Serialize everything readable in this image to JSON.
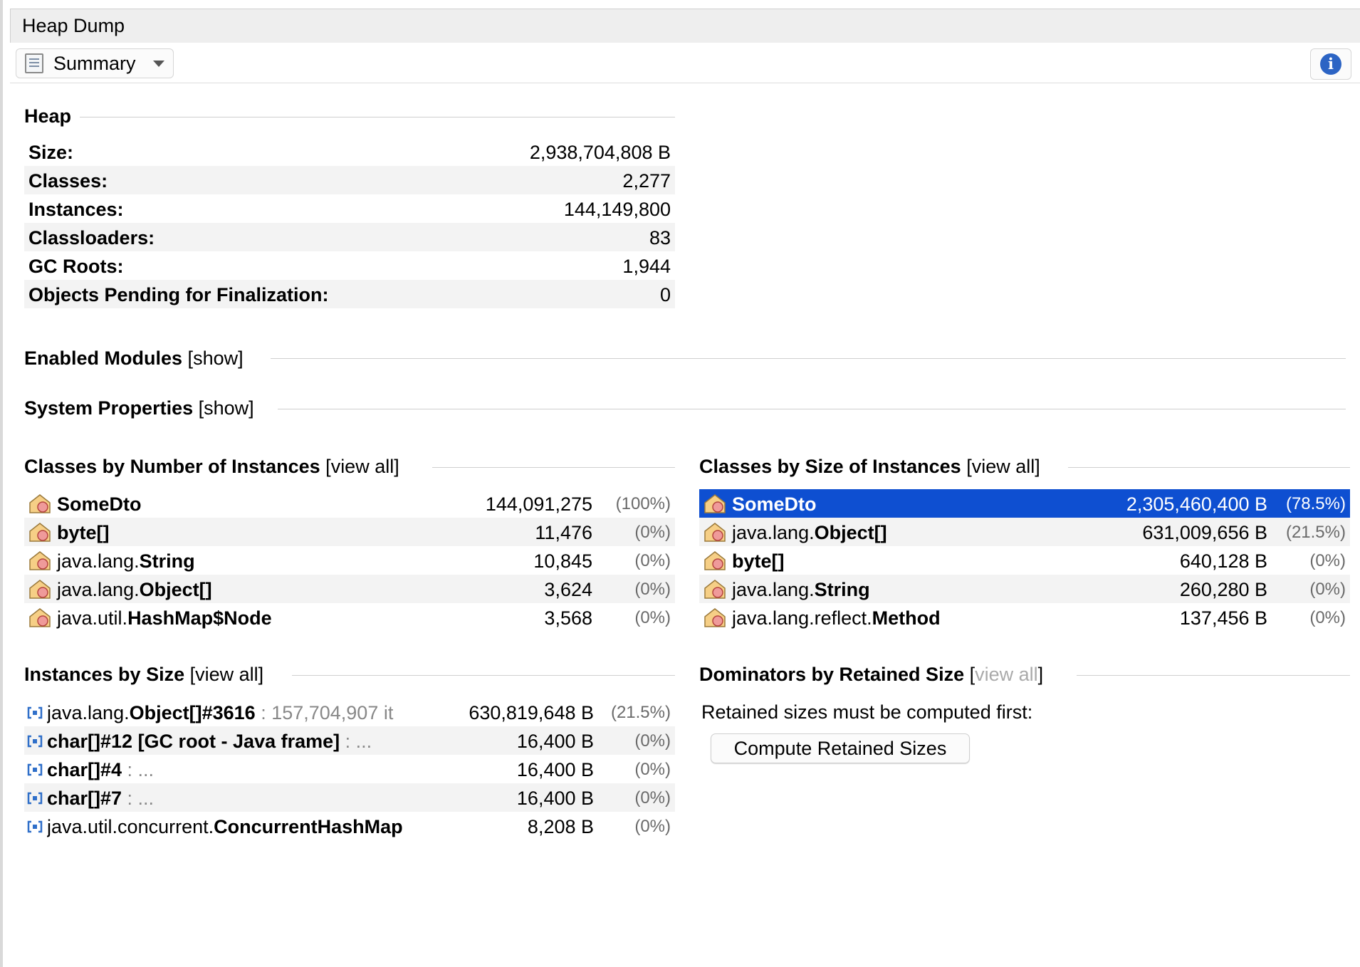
{
  "tab": {
    "title": "Heap Dump"
  },
  "toolbar": {
    "view_label": "Summary",
    "view_icon": "document-list-icon",
    "info_icon": "info-icon"
  },
  "heap": {
    "title": "Heap",
    "rows": [
      {
        "label": "Size:",
        "value": "2,938,704,808 B"
      },
      {
        "label": "Classes:",
        "value": "2,277"
      },
      {
        "label": "Instances:",
        "value": "144,149,800"
      },
      {
        "label": "Classloaders:",
        "value": "83"
      },
      {
        "label": "GC Roots:",
        "value": "1,944"
      },
      {
        "label": "Objects Pending for Finalization:",
        "value": "0"
      }
    ]
  },
  "modules": {
    "title": "Enabled Modules",
    "link": "show",
    "open": "[",
    "close": "]"
  },
  "sysprops": {
    "title": "System Properties",
    "link": "show",
    "open": "[",
    "close": "]"
  },
  "by_count": {
    "title": "Classes by Number of Instances",
    "link": "view all",
    "open": "[",
    "close": "]",
    "rows": [
      {
        "pkg": "",
        "cls": "SomeDto",
        "count": "144,091,275",
        "pct": "(100%)"
      },
      {
        "pkg": "",
        "cls": "byte[]",
        "count": "11,476",
        "pct": "(0%)"
      },
      {
        "pkg": "java.lang.",
        "cls": "String",
        "count": "10,845",
        "pct": "(0%)"
      },
      {
        "pkg": "java.lang.",
        "cls": "Object[]",
        "count": "3,624",
        "pct": "(0%)"
      },
      {
        "pkg": "java.util.",
        "cls": "HashMap$Node",
        "count": "3,568",
        "pct": "(0%)"
      }
    ]
  },
  "by_size": {
    "title": "Classes by Size of Instances",
    "link": "view all",
    "open": "[",
    "close": "]",
    "rows": [
      {
        "pkg": "",
        "cls": "SomeDto",
        "count": "2,305,460,400 B",
        "pct": "(78.5%)"
      },
      {
        "pkg": "java.lang.",
        "cls": "Object[]",
        "count": "631,009,656 B",
        "pct": "(21.5%)"
      },
      {
        "pkg": "",
        "cls": "byte[]",
        "count": "640,128 B",
        "pct": "(0%)"
      },
      {
        "pkg": "java.lang.",
        "cls": "String",
        "count": "260,280 B",
        "pct": "(0%)"
      },
      {
        "pkg": "java.lang.reflect.",
        "cls": "Method",
        "count": "137,456 B",
        "pct": "(0%)"
      }
    ]
  },
  "instances": {
    "title": "Instances by Size",
    "link": "view all",
    "open": "[",
    "close": "]",
    "rows": [
      {
        "pkg": "java.lang.",
        "cls": "Object[]#3616",
        "sub": " : 157,704,907 it",
        "size": "630,819,648 B",
        "pct": "(21.5%)"
      },
      {
        "pkg": "",
        "cls": "char[]#12 [GC root - Java frame]",
        "sub": " : ...",
        "size": "16,400 B",
        "pct": "(0%)"
      },
      {
        "pkg": "",
        "cls": "char[]#4",
        "sub": " : ...",
        "size": "16,400 B",
        "pct": "(0%)"
      },
      {
        "pkg": "",
        "cls": "char[]#7",
        "sub": " : ...",
        "size": "16,400 B",
        "pct": "(0%)"
      },
      {
        "pkg": "java.util.concurrent.",
        "cls": "ConcurrentHashMap",
        "sub": "",
        "size": "8,208 B",
        "pct": "(0%)"
      }
    ]
  },
  "dominators": {
    "title": "Dominators by Retained Size",
    "link": "view all",
    "open": "[",
    "close": "]",
    "message": "Retained sizes must be computed first:",
    "button": "Compute Retained Sizes"
  },
  "colors": {
    "selection": "#0e4fd1",
    "alt_row": "#f3f3f3",
    "info": "#2c64c4"
  }
}
